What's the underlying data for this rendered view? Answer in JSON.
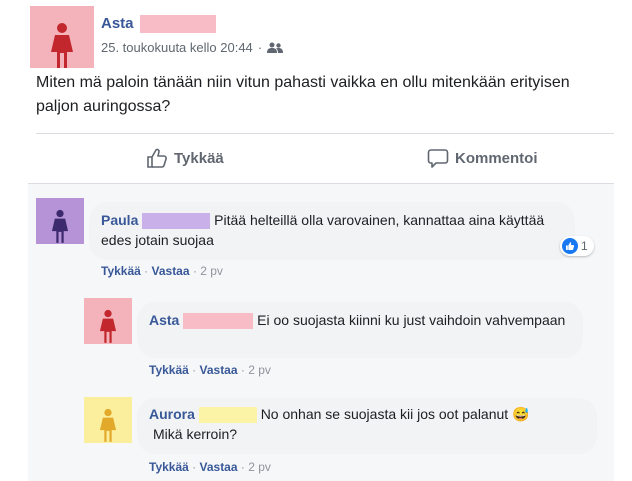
{
  "post": {
    "author": "Asta",
    "timestamp": "25. toukokuuta kello 20:44",
    "audience_icon": "friends-icon",
    "text": "Miten mä paloin tänään niin vitun pahasti vaikka en ollu mitenkään erityisen paljon auringossa?",
    "avatar_color": "#f4b3bb"
  },
  "actions": {
    "like_label": "Tykkää",
    "comment_label": "Kommentoi"
  },
  "comments": [
    {
      "author": "Paula",
      "text": "Pitää helteillä olla varovainen, kannattaa aina käyttää edes jotain suojaa",
      "like": "Tykkää",
      "reply": "Vastaa",
      "age": "2 pv",
      "reaction_count": "1",
      "avatar_color": "#b692d6",
      "redact_color": "#c9b0e8"
    },
    {
      "author": "Asta",
      "text": "Ei oo suojasta kiinni ku just vaihdoin vahvempaan",
      "like": "Tykkää",
      "reply": "Vastaa",
      "age": "2 pv",
      "avatar_color": "#f4b3bb",
      "redact_color": "#f7bcc6"
    },
    {
      "author": "Aurora",
      "text": "No onhan se suojasta kii jos oot palanut",
      "text2": "Mikä kerroin?",
      "emoji": "😅",
      "like": "Tykkää",
      "reply": "Vastaa",
      "age": "2 pv",
      "avatar_color": "#fbef9e",
      "redact_color": "#fbf3a6"
    }
  ],
  "colors": {
    "link_blue": "#385898",
    "comment_bg": "#f2f3f5",
    "comments_area_bg": "#f6f7f9"
  }
}
